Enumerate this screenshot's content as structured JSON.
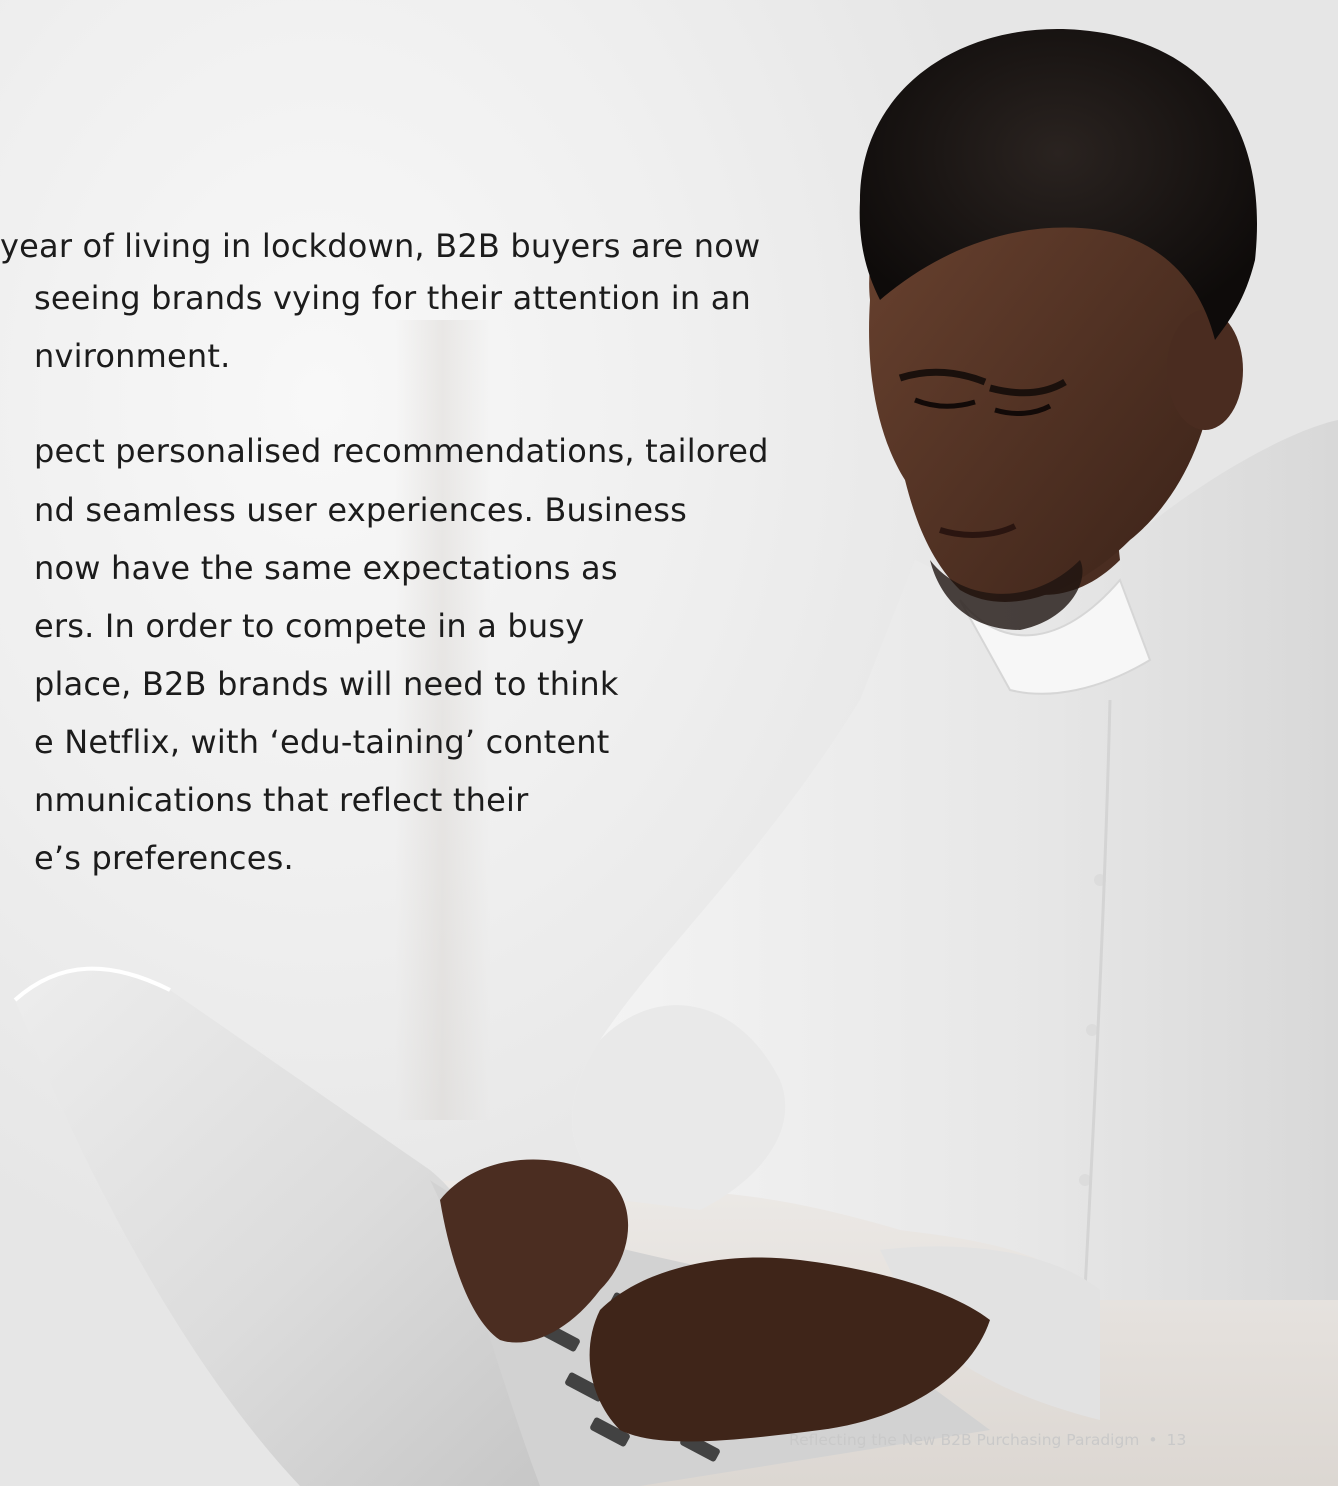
{
  "body_lines": [
    "year of living in lockdown, B2B buyers are now",
    "seeing brands vying for their attention in an",
    "nvironment.",
    "pect personalised recommendations, tailored",
    "nd seamless user experiences. Business",
    "now have the same expectations as",
    "ers. In order to compete in a busy",
    "place, B2B brands will need to think",
    "e Netflix, with ‘edu-taining’ content",
    "nmunications that reflect their",
    "e’s preferences."
  ],
  "footer": {
    "title": "Reflecting the New B2B Purchasing Paradigm",
    "separator": "•",
    "page_number": "13"
  }
}
